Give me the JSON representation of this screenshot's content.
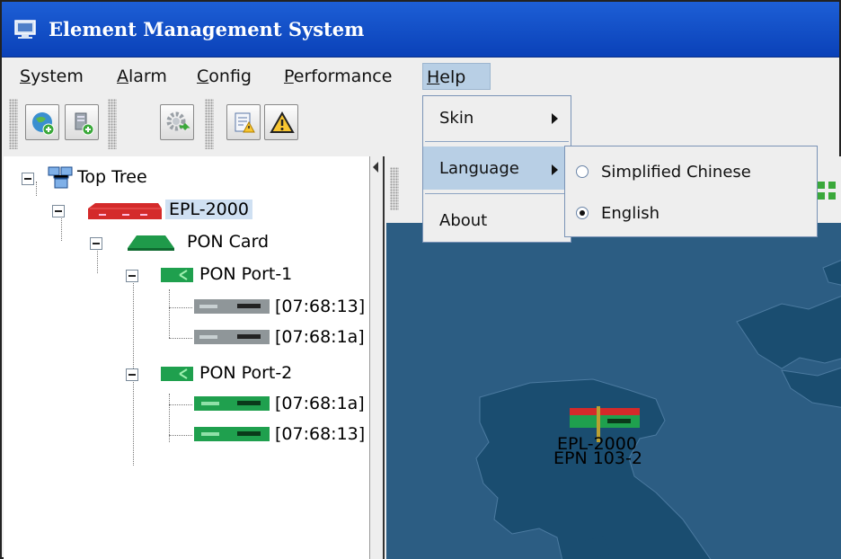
{
  "window": {
    "title": "Element Management System",
    "accent": "#0a41b8"
  },
  "menubar": {
    "items": [
      {
        "label": "System",
        "mnemonic": "S"
      },
      {
        "label": "Alarm",
        "mnemonic": "A"
      },
      {
        "label": "Config",
        "mnemonic": "C"
      },
      {
        "label": "Performance",
        "mnemonic": "P"
      },
      {
        "label": "Help",
        "mnemonic": "H",
        "open": true
      }
    ]
  },
  "toolbar": {
    "buttons": [
      {
        "icon": "globe-add-icon"
      },
      {
        "icon": "device-add-icon"
      },
      {
        "icon": "gear-icon"
      },
      {
        "icon": "report-alarm-icon"
      },
      {
        "icon": "warning-icon"
      }
    ]
  },
  "help_menu": {
    "items": [
      {
        "label": "Skin",
        "submenu": true
      },
      {
        "label": "Language",
        "submenu": true,
        "highlighted": true
      },
      {
        "label": "About",
        "submenu": false
      }
    ]
  },
  "language_menu": {
    "items": [
      {
        "label": "Simplified Chinese",
        "selected": false
      },
      {
        "label": "English",
        "selected": true
      }
    ]
  },
  "tree": {
    "root": "Top Tree",
    "device": "EPL-2000",
    "card": "PON Card",
    "ports": [
      {
        "label": "PON Port-1",
        "onus": [
          "[07:68:13]",
          "[07:68:1a]"
        ]
      },
      {
        "label": "PON Port-2",
        "onus": [
          "[07:68:1a]",
          "[07:68:13]"
        ]
      }
    ]
  },
  "map": {
    "node_labels": [
      "EPL-2000",
      "EPN 103-2"
    ],
    "ocean_color": "#2c5d83",
    "land_color": "#1a4d70"
  }
}
